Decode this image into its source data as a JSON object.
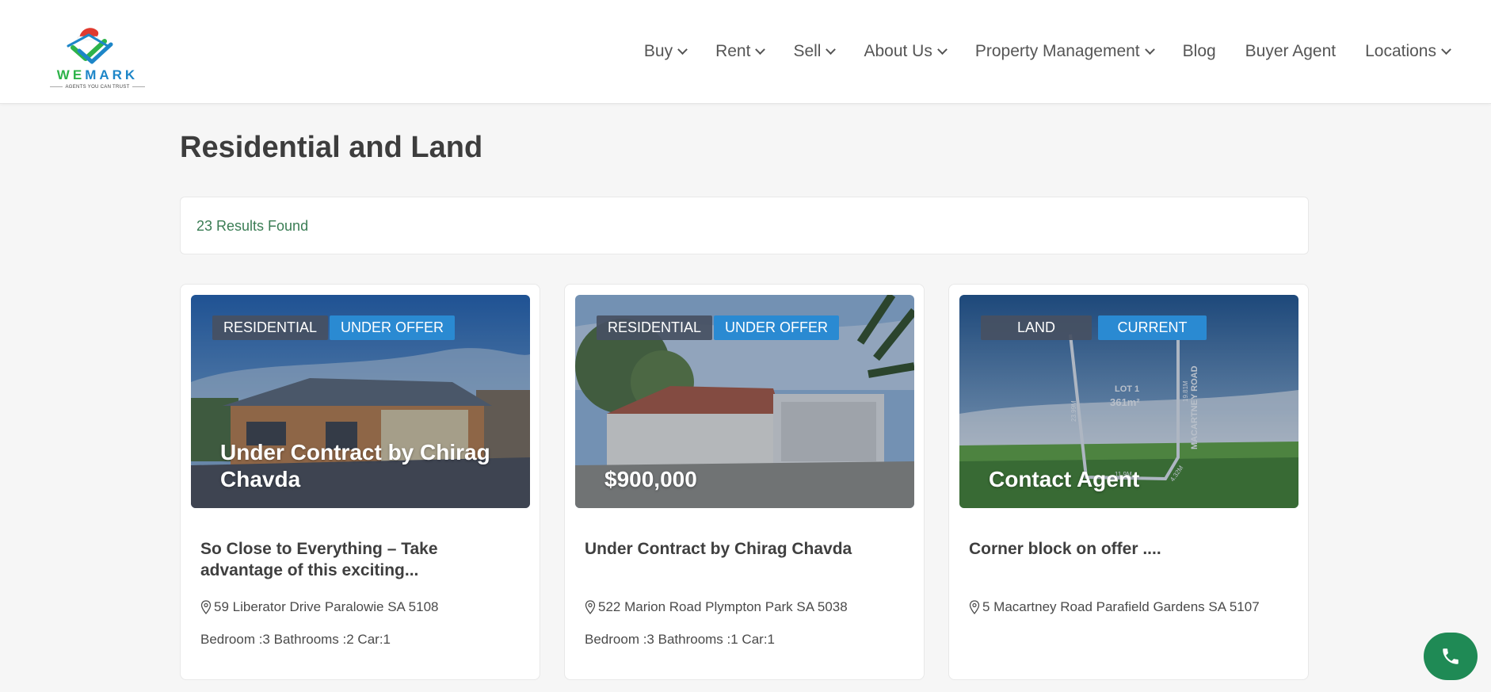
{
  "brand": {
    "name_part1": "WE",
    "name_part2": "MARK",
    "tagline": "AGENTS YOU CAN TRUST",
    "colors": {
      "green": "#2eb34a",
      "blue": "#1d86c8",
      "red": "#e03a2f"
    }
  },
  "nav": [
    {
      "label": "Buy",
      "dropdown": true
    },
    {
      "label": "Rent",
      "dropdown": true
    },
    {
      "label": "Sell",
      "dropdown": true
    },
    {
      "label": "About Us",
      "dropdown": true
    },
    {
      "label": "Property Management",
      "dropdown": true
    },
    {
      "label": "Blog",
      "dropdown": false
    },
    {
      "label": "Buyer Agent",
      "dropdown": false
    },
    {
      "label": "Locations",
      "dropdown": true
    }
  ],
  "page": {
    "title": "Residential and Land",
    "results": "23 Results Found"
  },
  "listings": [
    {
      "type": "RESIDENTIAL",
      "status": "UNDER OFFER",
      "price": "Under Contract by Chirag Chavda",
      "title": "So Close to Everything – Take advantage of this exciting...",
      "address": "59 Liberator Drive Paralowie SA 5108",
      "features": "Bedroom :3 Bathrooms :2 Car:1"
    },
    {
      "type": "RESIDENTIAL",
      "status": "UNDER OFFER",
      "price": "$900,000",
      "title": "Under Contract by Chirag Chavda",
      "address": "522 Marion Road Plympton Park SA 5038",
      "features": "Bedroom :3 Bathrooms :1 Car:1"
    },
    {
      "type": "LAND",
      "status": "CURRENT",
      "price": "Contact Agent",
      "title": "Corner block on offer ....",
      "address": "5 Macartney Road Parafield Gardens SA 5107",
      "features": "",
      "plan_labels": {
        "lot": "LOT 1",
        "area": "361m²",
        "road": "MACARTNEY ROAD",
        "dim1": "23.99M",
        "dim2": "19.81M",
        "dim3": "11.9M",
        "dim4": "4.32M"
      }
    }
  ],
  "icons": {
    "pin": "map-pin-icon",
    "phone": "phone-icon",
    "chevron": "chevron-down-icon"
  }
}
